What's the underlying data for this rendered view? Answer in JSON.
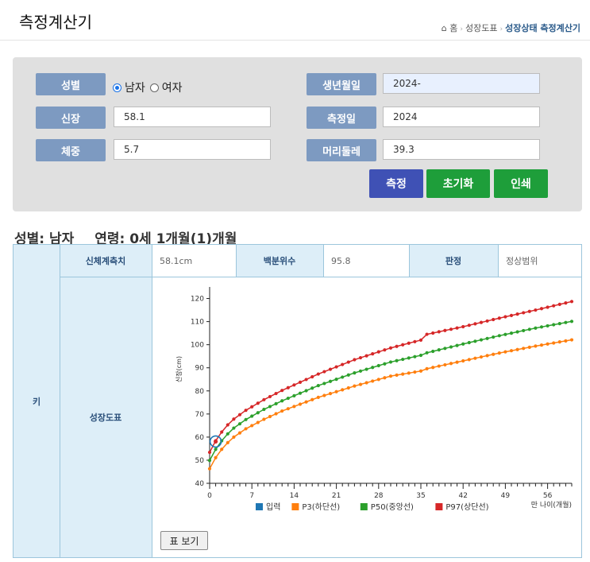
{
  "page": {
    "title": "측정계산기"
  },
  "breadcrumb": {
    "home": "홈",
    "item1": "성장도표",
    "current": "성장상태 측정계산기"
  },
  "form": {
    "gender_label": "성별",
    "gender_male": "남자",
    "gender_female": "여자",
    "gender_selected": "남자",
    "height_label": "신장",
    "height_value": "58.1",
    "weight_label": "체중",
    "weight_value": "5.7",
    "birth_label": "생년월일",
    "birth_value": "2024-",
    "measure_label": "측정일",
    "measure_value": "2024",
    "head_label": "머리둘레",
    "head_value": "39.3",
    "measure_button": "측정",
    "reset_button": "초기화",
    "print_button": "인쇄"
  },
  "summary": {
    "gender": "성별: 남자",
    "age": "연령: 0세 1개월(1)개월"
  },
  "result": {
    "row_label": "키",
    "col_measure": "신체계측치",
    "measure_value": "58.1cm",
    "col_percentile": "백분위수",
    "percentile_value": "95.8",
    "col_judge": "판정",
    "judge_value": "정상범위",
    "chart_label": "성장도표",
    "table_view_button": "표 보기"
  },
  "colors": {
    "input": "#1f77b4",
    "p3": "#ff7f0e",
    "p50": "#2ca02c",
    "p97": "#d62728",
    "label_bg": "#7d9ac1",
    "btn_blue": "#3f51b5",
    "btn_green": "#1e9e3a"
  },
  "chart_data": {
    "type": "line",
    "xlabel": "만 나이(개월)",
    "ylabel": "신장(cm)",
    "xlim": [
      0,
      60
    ],
    "ylim": [
      40,
      125
    ],
    "xticks": [
      0,
      7,
      14,
      21,
      28,
      35,
      42,
      49,
      56
    ],
    "yticks": [
      40,
      50,
      60,
      70,
      80,
      90,
      100,
      110,
      120
    ],
    "series": [
      {
        "name": "입력",
        "x": [
          1
        ],
        "y": [
          58.1
        ]
      },
      {
        "name": "P3(하단선)",
        "x": [
          0,
          1,
          2,
          3,
          4,
          6,
          9,
          12,
          18,
          24,
          30,
          35,
          36,
          42,
          48,
          54,
          60
        ],
        "y": [
          46.3,
          51.1,
          54.7,
          57.6,
          60.0,
          63.6,
          67.7,
          71.3,
          77.2,
          82.1,
          86.4,
          88.6,
          89.6,
          93.0,
          96.4,
          99.4,
          102.1
        ]
      },
      {
        "name": "P50(중앙선)",
        "x": [
          0,
          1,
          2,
          3,
          4,
          6,
          9,
          12,
          18,
          24,
          30,
          35,
          36,
          42,
          48,
          54,
          60
        ],
        "y": [
          49.9,
          54.7,
          58.4,
          61.4,
          63.9,
          67.6,
          72.0,
          75.7,
          82.3,
          87.8,
          92.5,
          95.4,
          96.5,
          100.3,
          103.9,
          107.2,
          110.1
        ]
      },
      {
        "name": "P97(상단선)",
        "x": [
          0,
          1,
          2,
          3,
          4,
          6,
          9,
          12,
          18,
          24,
          30,
          35,
          36,
          42,
          48,
          54,
          60
        ],
        "y": [
          53.4,
          58.4,
          62.2,
          65.3,
          67.8,
          71.6,
          76.2,
          80.2,
          87.3,
          93.5,
          98.6,
          102.0,
          104.5,
          107.8,
          111.5,
          115.0,
          118.7
        ]
      }
    ]
  }
}
